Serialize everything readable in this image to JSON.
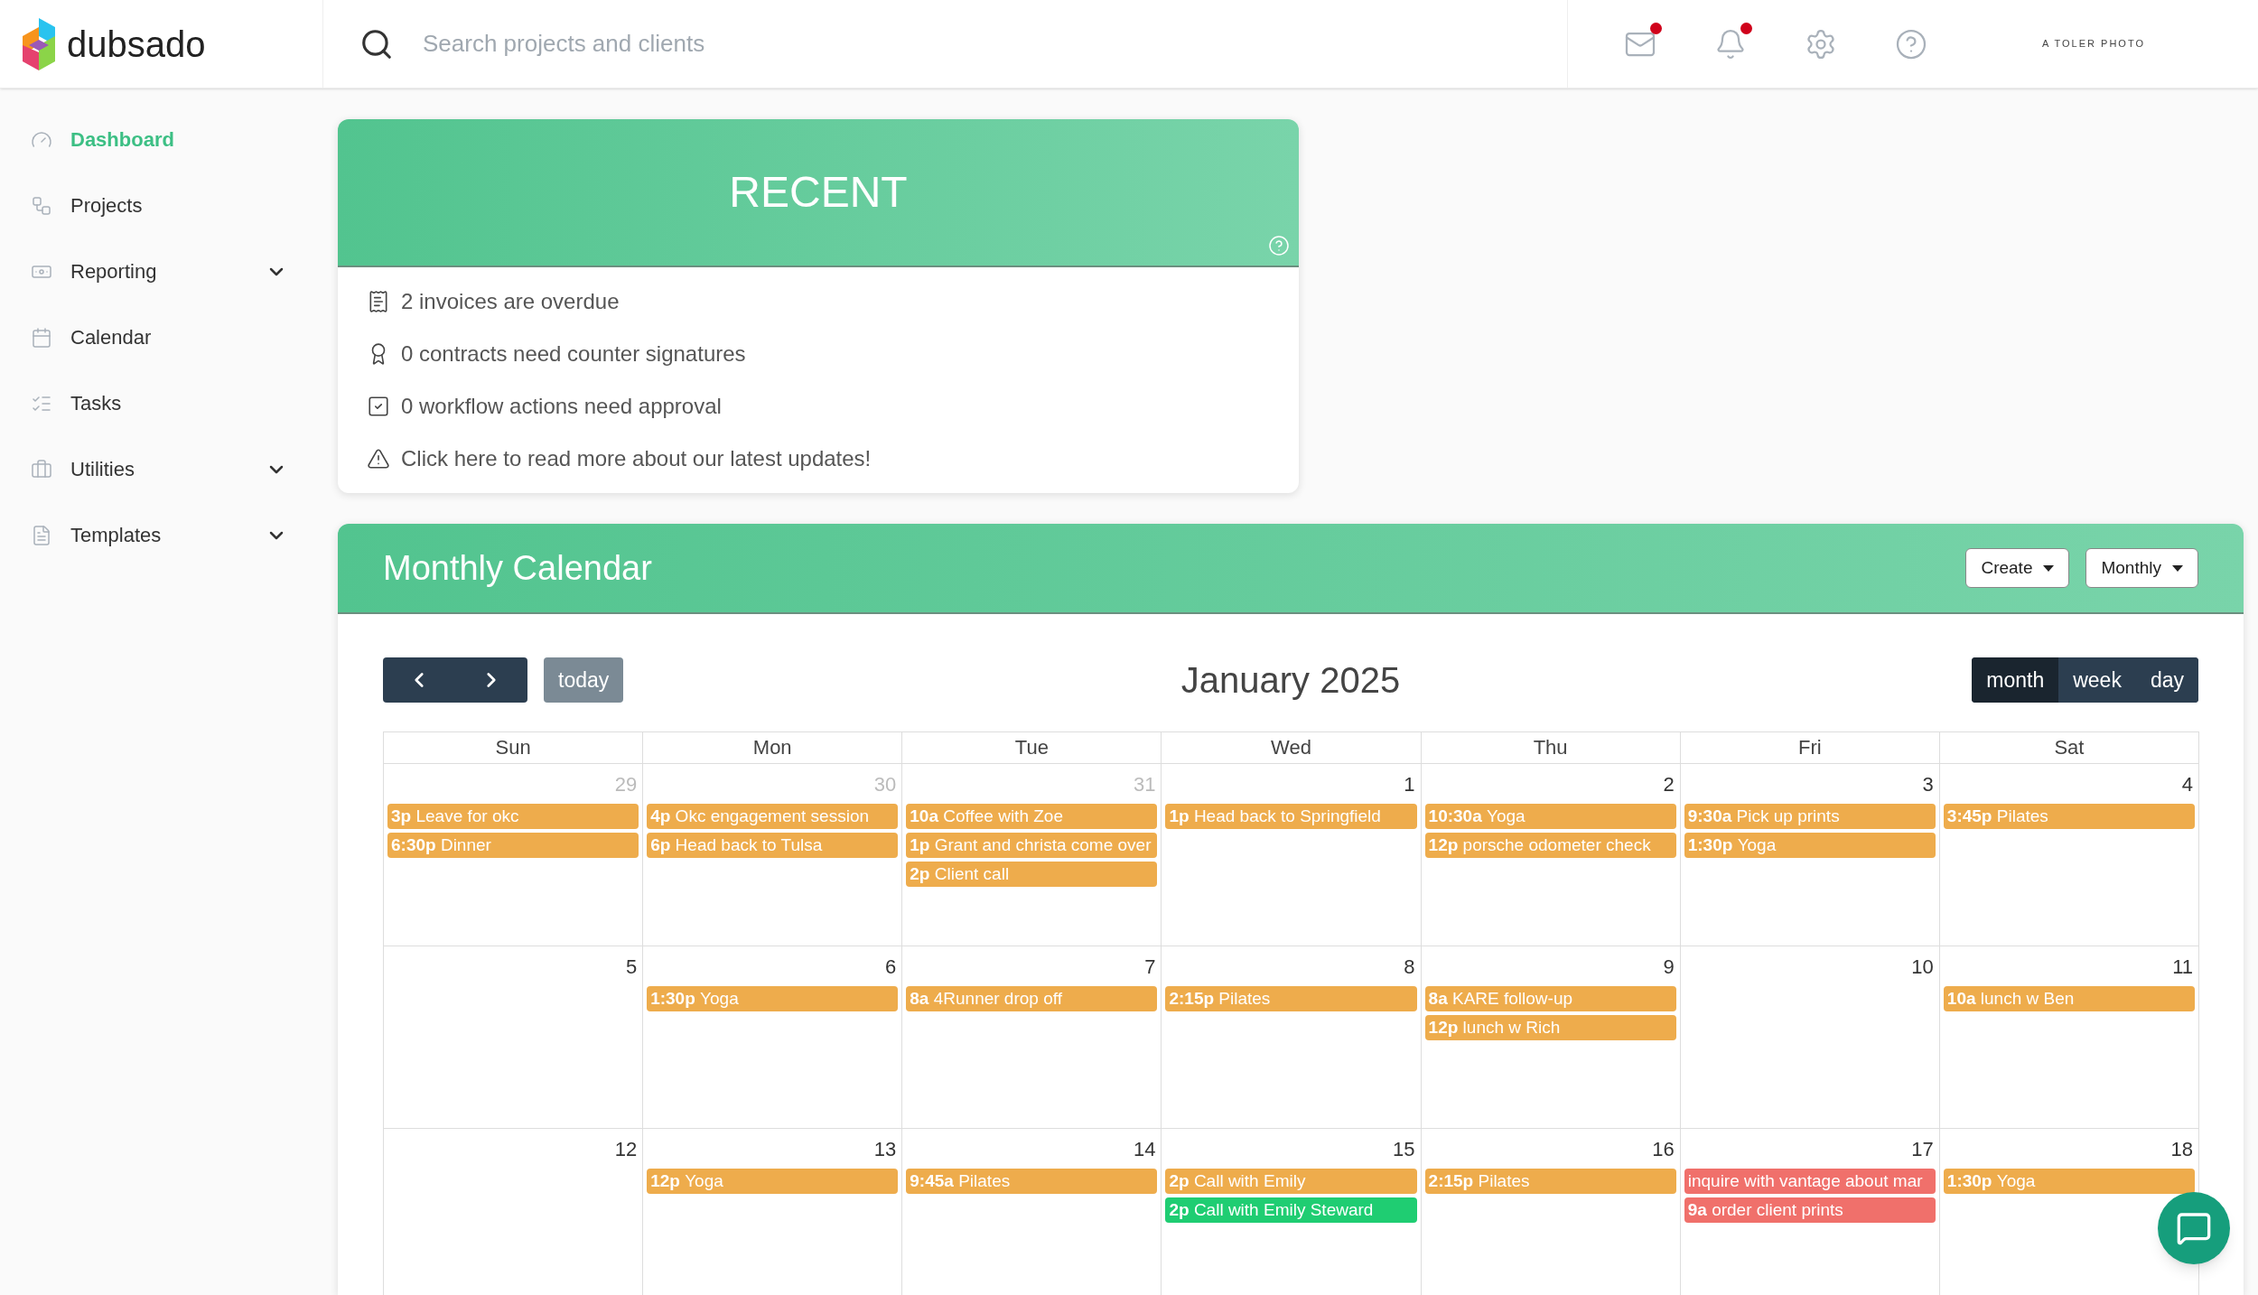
{
  "header": {
    "logo": "dubsado",
    "search": {
      "placeholder": "Search projects and clients"
    },
    "icons": [
      {
        "kind": "mail",
        "badge": true
      },
      {
        "kind": "bell",
        "badge": true
      },
      {
        "kind": "settings",
        "badge": false
      },
      {
        "kind": "help",
        "badge": false
      }
    ],
    "brand": "A TOLER PHOTO"
  },
  "sidebar": {
    "items": [
      {
        "kind": "dashboard",
        "label": "Dashboard",
        "selected": true,
        "has_submenu": false
      },
      {
        "kind": "projects",
        "label": "Projects",
        "selected": false,
        "has_submenu": false
      },
      {
        "kind": "reporting",
        "label": "Reporting",
        "selected": false,
        "has_submenu": true
      },
      {
        "kind": "calendar",
        "label": "Calendar",
        "selected": false,
        "has_submenu": false
      },
      {
        "kind": "tasks",
        "label": "Tasks",
        "selected": false,
        "has_submenu": false
      },
      {
        "kind": "utilities",
        "label": "Utilities",
        "selected": false,
        "has_submenu": true
      },
      {
        "kind": "templates",
        "label": "Templates",
        "selected": false,
        "has_submenu": true
      }
    ]
  },
  "recent": {
    "title": "RECENT",
    "items": [
      {
        "kind": "invoice",
        "text": "2 invoices are overdue"
      },
      {
        "kind": "contract",
        "text": "0 contracts need counter signatures"
      },
      {
        "kind": "approval",
        "text": "0 workflow actions need approval"
      },
      {
        "kind": "warning",
        "text": "Click here to read more about our latest updates!"
      }
    ]
  },
  "calendar": {
    "title": "Monthly Calendar",
    "buttons": [
      "Create",
      "Monthly"
    ],
    "month": "January 2025",
    "today": "today",
    "views": [
      {
        "label": "month",
        "selected": true
      },
      {
        "label": "week",
        "selected": false
      },
      {
        "label": "day",
        "selected": false
      }
    ],
    "weekdays": [
      "Sun",
      "Mon",
      "Tue",
      "Wed",
      "Thu",
      "Fri",
      "Sat"
    ],
    "weeks": [
      [
        {
          "day": "29",
          "other_month": true,
          "events": [
            {
              "time": "3p",
              "title": "Leave for okc",
              "color": "#eeac4c"
            },
            {
              "time": "6:30p",
              "title": "Dinner",
              "color": "#eeac4c"
            }
          ]
        },
        {
          "day": "30",
          "other_month": true,
          "events": [
            {
              "time": "4p",
              "title": "Okc engagement session",
              "color": "#eeac4c"
            },
            {
              "time": "6p",
              "title": "Head back to Tulsa",
              "color": "#eeac4c"
            }
          ]
        },
        {
          "day": "31",
          "other_month": true,
          "events": [
            {
              "time": "10a",
              "title": "Coffee with Zoe",
              "color": "#eeac4c"
            },
            {
              "time": "1p",
              "title": "Grant and christa come over",
              "color": "#eeac4c"
            },
            {
              "time": "2p",
              "title": "Client call",
              "color": "#eeac4c"
            }
          ]
        },
        {
          "day": "1",
          "other_month": false,
          "events": [
            {
              "time": "1p",
              "title": "Head back to Springfield",
              "color": "#eeac4c"
            }
          ]
        },
        {
          "day": "2",
          "other_month": false,
          "events": [
            {
              "time": "10:30a",
              "title": "Yoga",
              "color": "#eeac4c"
            },
            {
              "time": "12p",
              "title": "porsche odometer check",
              "color": "#eeac4c"
            }
          ]
        },
        {
          "day": "3",
          "other_month": false,
          "events": [
            {
              "time": "9:30a",
              "title": "Pick up prints",
              "color": "#eeac4c"
            },
            {
              "time": "1:30p",
              "title": "Yoga",
              "color": "#eeac4c"
            }
          ]
        },
        {
          "day": "4",
          "other_month": false,
          "events": [
            {
              "time": "3:45p",
              "title": "Pilates",
              "color": "#eeac4c"
            }
          ]
        }
      ],
      [
        {
          "day": "5",
          "other_month": false
        },
        {
          "day": "6",
          "other_month": false,
          "events": [
            {
              "time": "1:30p",
              "title": "Yoga",
              "color": "#eeac4c"
            }
          ]
        },
        {
          "day": "7",
          "other_month": false,
          "events": [
            {
              "time": "8a",
              "title": "4Runner drop off",
              "color": "#eeac4c"
            }
          ]
        },
        {
          "day": "8",
          "other_month": false,
          "events": [
            {
              "time": "2:15p",
              "title": "Pilates",
              "color": "#eeac4c"
            }
          ]
        },
        {
          "day": "9",
          "other_month": false,
          "events": [
            {
              "time": "8a",
              "title": "KARE follow-up",
              "color": "#eeac4c"
            },
            {
              "time": "12p",
              "title": "lunch w Rich",
              "color": "#eeac4c"
            }
          ]
        },
        {
          "day": "10",
          "other_month": false
        },
        {
          "day": "11",
          "other_month": false,
          "events": [
            {
              "time": "10a",
              "title": "lunch w Ben",
              "color": "#eeac4c"
            }
          ]
        }
      ],
      [
        {
          "day": "12",
          "other_month": false
        },
        {
          "day": "13",
          "other_month": false,
          "events": [
            {
              "time": "12p",
              "title": "Yoga",
              "color": "#eeac4c"
            }
          ]
        },
        {
          "day": "14",
          "other_month": false,
          "events": [
            {
              "time": "9:45a",
              "title": "Pilates",
              "color": "#eeac4c"
            }
          ]
        },
        {
          "day": "15",
          "other_month": false,
          "events": [
            {
              "time": "2p",
              "title": "Call with Emily",
              "color": "#eeac4c"
            },
            {
              "time": "2p",
              "title": "Call with Emily Steward",
              "color": "#1fcd72"
            }
          ]
        },
        {
          "day": "16",
          "other_month": false,
          "events": [
            {
              "time": "2:15p",
              "title": "Pilates",
              "color": "#eeac4c"
            }
          ]
        },
        {
          "day": "17",
          "other_month": false,
          "events": [
            {
              "title": "inquire with vantage about mar",
              "color": "#f0706b"
            },
            {
              "time": "9a",
              "title": "order client prints",
              "color": "#f0706b"
            }
          ]
        },
        {
          "day": "18",
          "other_month": false,
          "events": [
            {
              "time": "1:30p",
              "title": "Yoga",
              "color": "#eeac4c"
            }
          ]
        }
      ]
    ]
  }
}
